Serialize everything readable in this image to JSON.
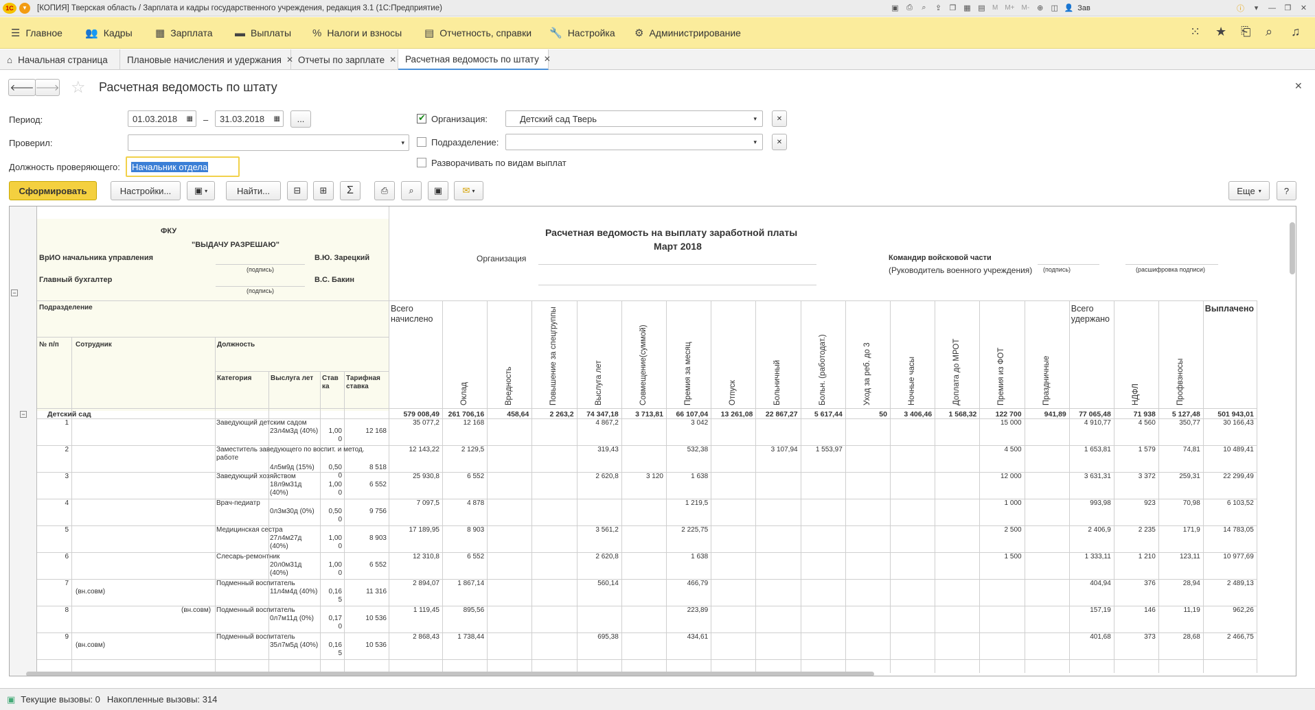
{
  "window": {
    "title": "[КОПИЯ] Тверская область / Зарплата и кадры государственного учреждения, редакция 3.1  (1С:Предприятие)",
    "logo": "1С",
    "user_short": "Зав",
    "toolbar_text": [
      "M",
      "M+",
      "M-"
    ]
  },
  "main_menu": [
    {
      "label": "Главное",
      "icon": "hamburger-icon"
    },
    {
      "label": "Кадры",
      "icon": "people-icon"
    },
    {
      "label": "Зарплата",
      "icon": "calculator-icon"
    },
    {
      "label": "Выплаты",
      "icon": "wallet-icon"
    },
    {
      "label": "Налоги и взносы",
      "icon": "percent-icon"
    },
    {
      "label": "Отчетность, справки",
      "icon": "report-icon"
    },
    {
      "label": "Настройка",
      "icon": "wrench-icon"
    },
    {
      "label": "Администрирование",
      "icon": "gear-icon"
    }
  ],
  "tabs": [
    {
      "label": "Начальная страница",
      "icon": "home-icon"
    },
    {
      "label": "Плановые начисления и удержания"
    },
    {
      "label": "Отчеты по зарплате"
    },
    {
      "label": "Расчетная ведомость по штату",
      "active": true
    }
  ],
  "form": {
    "title": "Расчетная ведомость по штату",
    "period_label": "Период:",
    "period_from": "01.03.2018",
    "period_sep": "–",
    "period_to": "31.03.2018",
    "period_more": "...",
    "checked_by_label": "Проверил:",
    "checked_by_value": "",
    "position_label": "Должность проверяющего:",
    "position_value": "Начальник отдела",
    "org_label": "Организация:",
    "org_value": "Детский сад Тверь",
    "org_checked": true,
    "dept_label": "Подразделение:",
    "dept_value": "",
    "expand_label": "Разворачивать по видам выплат"
  },
  "toolbar": {
    "generate": "Сформировать",
    "settings": "Настройки...",
    "find": "Найти...",
    "more": "Еще",
    "help": "?",
    "sum": "Σ"
  },
  "report": {
    "fku": "ФКУ",
    "approve": "\"ВЫДАЧУ РАЗРЕШАЮ\"",
    "head_role": "ВрИО начальника управления",
    "head_name": "В.Ю. Зарецкий",
    "accountant_role": "Главный бухгалтер",
    "accountant_name": "В.С. Бакин",
    "sign_hint": "(подпись)",
    "title_line1": "Расчетная ведомость на выплату заработной платы",
    "title_line2": "Март 2018",
    "org_label": "Организация",
    "commander_line1": "Командир войсковой части",
    "commander_line2": "(Руководитель военного учреждения)",
    "sign_hint2": "(подпись)",
    "sign_decode": "(расшифровка подписи)",
    "hdr_dept": "Подразделение",
    "hdr_no": "№ п/п",
    "hdr_employee": "Сотрудник",
    "hdr_position": "Должность",
    "hdr_category": "Категория",
    "hdr_service": "Выслуга лет",
    "hdr_rate": "Став ка",
    "hdr_tariff": "Тарифная ставка",
    "hdr_total_accr": "Всего начислено",
    "hdr_total_ded": "Всего удержано",
    "hdr_paid": "Выплачено",
    "vertical_headers": [
      "Оклад",
      "Вредность",
      "Повышение за спецгруппы",
      "Выслуга лет",
      "Совмещение(суммой)",
      "Премия за месяц",
      "Отпуск",
      "Больничный",
      "Больн. (работодат.)",
      "Уход за реб. до 3",
      "Ночные часы",
      "Доплата до МРОТ",
      "Премия из ФОТ",
      "Праздничные"
    ],
    "vertical_headers2": [
      "НДФЛ",
      "Профвзносы"
    ],
    "group": {
      "name": "Детский сад",
      "values": [
        "579 008,49",
        "261 706,16",
        "458,64",
        "2 263,2",
        "74 347,18",
        "3 713,81",
        "66 107,04",
        "13 261,08",
        "22 867,27",
        "5 617,44",
        "50",
        "3 406,46",
        "1 568,32",
        "122 700",
        "941,89",
        "77 065,48",
        "71 938",
        "5 127,48",
        "501 943,01"
      ]
    },
    "rows": [
      {
        "n": "1",
        "emp": "",
        "emp2": "",
        "pos": "Заведующий детским садом",
        "pos2": "",
        "cat": "",
        "svc": "23л4м3д (40%)",
        "rate": "1,00",
        "rate2": "0",
        "tariff": "12 168",
        "total": "35 077,2",
        "vals": {
          "0": "12 168",
          "3": "4 867,2",
          "5": "3 042",
          "12": "15 000"
        },
        "ded": "4 910,77",
        "ndfl": "4 560",
        "prof": "350,77",
        "paid": "30 166,43"
      },
      {
        "n": "2",
        "emp": "",
        "emp2": "",
        "pos": "Заместитель заведующего по воспит. и метод.",
        "pos2": "работе",
        "cat": "",
        "svc": "4л5м9д (15%)",
        "rate": "0,50",
        "rate2": "0",
        "tariff": "8 518",
        "total": "12 143,22",
        "vals": {
          "0": "2 129,5",
          "3": "319,43",
          "5": "532,38",
          "7": "3 107,94",
          "8": "1 553,97",
          "12": "4 500"
        },
        "ded": "1 653,81",
        "ndfl": "1 579",
        "prof": "74,81",
        "paid": "10 489,41"
      },
      {
        "n": "3",
        "emp": "",
        "emp2": "",
        "pos": "Заведующий хозяйством",
        "pos2": "",
        "cat": "",
        "svc": "18л9м31д (40%)",
        "rate": "1,00",
        "rate2": "0",
        "tariff": "6 552",
        "total": "25 930,8",
        "vals": {
          "0": "6 552",
          "3": "2 620,8",
          "4": "3 120",
          "5": "1 638",
          "12": "12 000"
        },
        "ded": "3 631,31",
        "ndfl": "3 372",
        "prof": "259,31",
        "paid": "22 299,49"
      },
      {
        "n": "4",
        "emp": "",
        "emp2": "",
        "pos": "Врач-педиатр",
        "pos2": "",
        "cat": "",
        "svc": "0л3м30д (0%)",
        "rate": "0,50",
        "rate2": "0",
        "tariff": "9 756",
        "total": "7 097,5",
        "vals": {
          "0": "4 878",
          "5": "1 219,5",
          "12": "1 000"
        },
        "ded": "993,98",
        "ndfl": "923",
        "prof": "70,98",
        "paid": "6 103,52"
      },
      {
        "n": "5",
        "emp": "",
        "emp2": "",
        "pos": "Медицинская сестра",
        "pos2": "",
        "cat": "",
        "svc": "27л4м27д (40%)",
        "rate": "1,00",
        "rate2": "0",
        "tariff": "8 903",
        "total": "17 189,95",
        "vals": {
          "0": "8 903",
          "3": "3 561,2",
          "5": "2 225,75",
          "12": "2 500"
        },
        "ded": "2 406,9",
        "ndfl": "2 235",
        "prof": "171,9",
        "paid": "14 783,05"
      },
      {
        "n": "6",
        "emp": "",
        "emp2": "",
        "pos": "Слесарь-ремонтник",
        "pos2": "",
        "cat": "",
        "svc": "20л0м31д (40%)",
        "rate": "1,00",
        "rate2": "0",
        "tariff": "6 552",
        "total": "12 310,8",
        "vals": {
          "0": "6 552",
          "3": "2 620,8",
          "5": "1 638",
          "12": "1 500"
        },
        "ded": "1 333,11",
        "ndfl": "1 210",
        "prof": "123,11",
        "paid": "10 977,69"
      },
      {
        "n": "7",
        "emp": "",
        "emp2": "(вн.совм)",
        "pos": "Подменный воспитатель",
        "pos2": "",
        "cat": "",
        "svc": "11л4м4д (40%)",
        "rate": "0,16",
        "rate2": "5",
        "tariff": "11 316",
        "total": "2 894,07",
        "vals": {
          "0": "1 867,14",
          "3": "560,14",
          "5": "466,79"
        },
        "ded": "404,94",
        "ndfl": "376",
        "prof": "28,94",
        "paid": "2 489,13"
      },
      {
        "n": "8",
        "emp": "(вн.совм)",
        "emp2": "",
        "pos": "Подменный воспитатель",
        "pos2": "",
        "cat": "",
        "svc": "0л7м11д (0%)",
        "rate": "0,17",
        "rate2": "0",
        "tariff": "10 536",
        "total": "1 119,45",
        "vals": {
          "0": "895,56",
          "5": "223,89"
        },
        "ded": "157,19",
        "ndfl": "146",
        "prof": "11,19",
        "paid": "962,26"
      },
      {
        "n": "9",
        "emp": "",
        "emp2": "(вн.совм)",
        "pos": "Подменный воспитатель",
        "pos2": "",
        "cat": "",
        "svc": "35л7м5д (40%)",
        "rate": "0,16",
        "rate2": "5",
        "tariff": "10 536",
        "total": "2 868,43",
        "vals": {
          "0": "1 738,44",
          "3": "695,38",
          "5": "434,61"
        },
        "ded": "401,68",
        "ndfl": "373",
        "prof": "28,68",
        "paid": "2 466,75"
      }
    ]
  },
  "status": {
    "current_calls": "Текущие вызовы: 0",
    "accumulated_calls": "Накопленные вызовы: 314"
  }
}
